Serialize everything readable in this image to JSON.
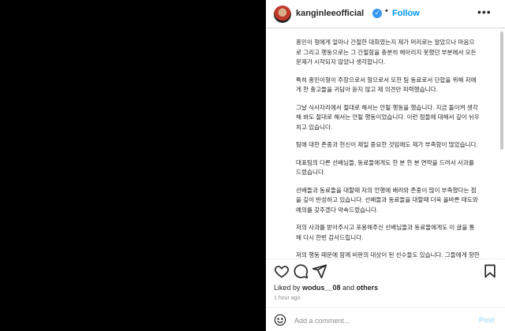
{
  "header": {
    "username": "kanginleeofficial",
    "dot": "•",
    "follow_label": "Follow",
    "more_icon": "more-horizontal-icon"
  },
  "caption": {
    "separator": "⠀",
    "paragraphs": [
      "홍민이 형에게 얼마나 간절한 대회였는지 제가 머리로는 알았으나 마음으로 그리고 행동으로는 그 간절함을 충분히 헤아리지 못했던 부분에서 모든 문제가 시작되지 않았나 생각합니다.",
      "특히 홍민이형이 주장으로서 형으로서 또한 팀 동료로서 단합을 위해 저에게 한 충고들을 귀담아 듣지 않고 제 의견만 피력했습니다.",
      "그날 식사자리에서 절대로 해서는 안될 행동을 했습니다. 지금 돌이켜 생각해 봐도 절대로 해서는 안될 행동이었습니다. 이런 점들에 대해서 깊이 뉘우치고 있습니다.",
      "팀에 대한 존중과 헌신이 제일 중요한 것임에도 제가 부족함이 많았습니다.",
      "대표팀의 다른 선배님들, 동료들에게도 한 분 한 분 연락을 드려서 사과를 드렸습니다.",
      "선배들과 동료들을 대할때 저의 언행에 배려와 존중이 많이 부족했다는 점을 깊이 반성하고 있습니다. 선배들과 동료들을 대할때 더욱 올바른 태도와 예의를 갖추겠다 약속드렸습니다.",
      "저의 사과를 받아주시고 포용해주신 선배님들과 동료들에게도 이 글을 통해 다시 한번 감사드립니다.",
      "저의 행동 때문에 함께 비판의 대상이 된 선수들도 있습니다. 그들에게 향한 비판 또한 제가 받아야한다고 생각합니다."
    ]
  },
  "actions": {
    "like_icon": "heart-icon",
    "comment_icon": "comment-icon",
    "share_icon": "paper-plane-icon",
    "save_icon": "bookmark-icon"
  },
  "likes": {
    "prefix": "Liked by ",
    "user": "wodus__08",
    "middle": " and ",
    "others": "others"
  },
  "timestamp": "1 hour ago",
  "comment": {
    "emoji_icon": "smiley-icon",
    "placeholder": "Add a comment...",
    "post_label": "Post"
  },
  "colors": {
    "accent": "#0095f6",
    "verified": "#3897f0",
    "muted": "#8e8e8e",
    "text": "#262626"
  }
}
